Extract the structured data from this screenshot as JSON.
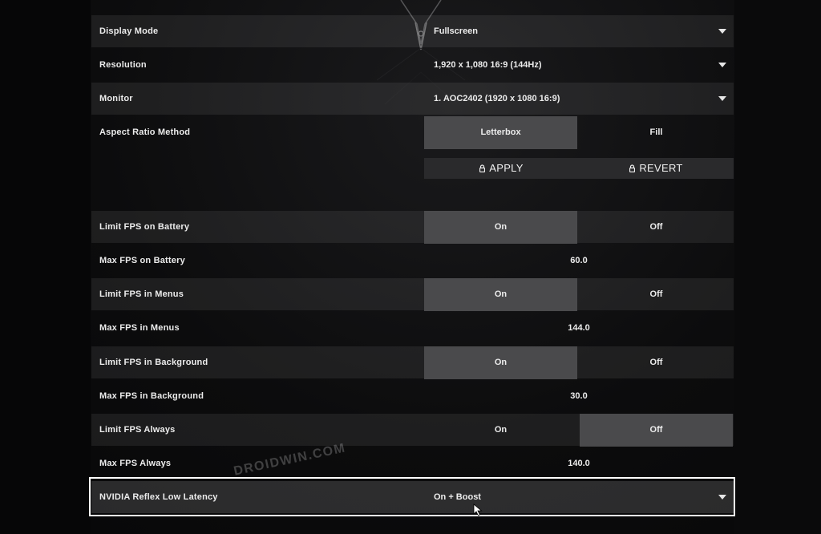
{
  "settings": {
    "display_mode": {
      "label": "Display Mode",
      "value": "Fullscreen"
    },
    "resolution": {
      "label": "Resolution",
      "value": "1,920 x 1,080 16:9 (144Hz)"
    },
    "monitor": {
      "label": "Monitor",
      "value": "1. AOC2402 (1920 x  1080 16:9)"
    },
    "aspect_ratio": {
      "label": "Aspect Ratio Method",
      "option_a": "Letterbox",
      "option_b": "Fill",
      "selected": "Letterbox"
    },
    "apply_label": "APPLY",
    "revert_label": "REVERT",
    "limit_fps_battery": {
      "label": "Limit FPS on Battery",
      "on": "On",
      "off": "Off",
      "selected": "On"
    },
    "max_fps_battery": {
      "label": "Max FPS on Battery",
      "value": "60.0"
    },
    "limit_fps_menus": {
      "label": "Limit FPS in Menus",
      "on": "On",
      "off": "Off",
      "selected": "On"
    },
    "max_fps_menus": {
      "label": "Max FPS in Menus",
      "value": "144.0"
    },
    "limit_fps_background": {
      "label": "Limit FPS in Background",
      "on": "On",
      "off": "Off",
      "selected": "On"
    },
    "max_fps_background": {
      "label": "Max FPS in Background",
      "value": "30.0"
    },
    "limit_fps_always": {
      "label": "Limit FPS Always",
      "on": "On",
      "off": "Off",
      "selected": "Off"
    },
    "max_fps_always": {
      "label": "Max FPS Always",
      "value": "140.0"
    },
    "nvidia_reflex": {
      "label": "NVIDIA Reflex Low Latency",
      "value": "On + Boost"
    }
  },
  "watermark": "DROIDWIN.COM",
  "colors": {
    "row_shade": "#1f1f21",
    "active_toggle": "#4a4a4c",
    "highlight_border": "#ffffff"
  },
  "icons": {
    "dropdown": "caret-down-icon",
    "lock": "lock-icon",
    "cursor": "mouse-pointer-icon"
  }
}
